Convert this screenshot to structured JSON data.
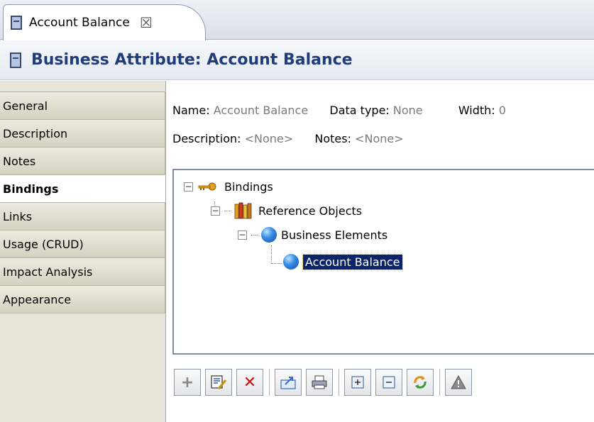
{
  "tab": {
    "label": "Account Balance",
    "close_glyph": "☒"
  },
  "header": {
    "title": "Business Attribute: Account Balance"
  },
  "nav": {
    "items": [
      {
        "label": "General"
      },
      {
        "label": "Description"
      },
      {
        "label": "Notes"
      },
      {
        "label": "Bindings",
        "active": true
      },
      {
        "label": "Links"
      },
      {
        "label": "Usage (CRUD)"
      },
      {
        "label": "Impact Analysis"
      },
      {
        "label": "Appearance"
      }
    ]
  },
  "properties": {
    "name_label": "Name:",
    "name_value": "Account Balance",
    "datatype_label": "Data type:",
    "datatype_value": "None",
    "width_label": "Width:",
    "width_value": "0",
    "description_label": "Description:",
    "description_value": "<None>",
    "notes_label": "Notes:",
    "notes_value": "<None>"
  },
  "tree": {
    "root": "Bindings",
    "reference_objects": "Reference Objects",
    "business_elements": "Business Elements",
    "selected_item": "Account Balance",
    "expanded_glyph": "−"
  },
  "toolbar": {
    "add": "+",
    "delete": "✕",
    "buttons": [
      "add-icon",
      "edit-icon",
      "delete-icon",
      "export-icon",
      "print-icon",
      "expand-icon",
      "collapse-icon",
      "refresh-icon",
      "warning-icon"
    ]
  },
  "colors": {
    "header_text": "#1f3d7a",
    "selection": "#0a246a",
    "delete_red": "#d01010"
  }
}
